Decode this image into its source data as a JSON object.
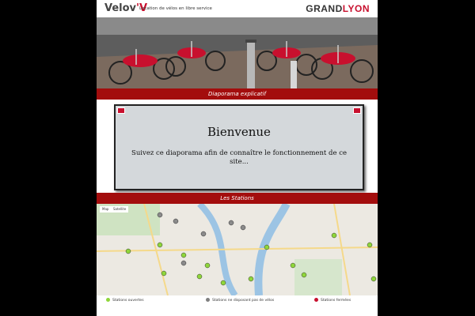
{
  "header": {
    "logo_main": "Velov",
    "logo_accent": "'V",
    "tagline": "Location de vélos en libre service",
    "brand_a": "GRAND",
    "brand_b": "LYON"
  },
  "sections": {
    "diaporama_label": "Diaporama explicatif",
    "stations_label": "Les Stations"
  },
  "slide": {
    "title": "Bienvenue",
    "text": "Suivez ce diaporama afin de connaître le fonctionnement de ce site..."
  },
  "map": {
    "map_button": "Map",
    "satellite_button": "Satellite"
  },
  "legend": {
    "open": "Stations ouvertes",
    "no_bikes": "Stations ne disposant pas de vélos",
    "closed": "Stations fermées"
  },
  "colors": {
    "accent": "#a30d0d",
    "open": "#8fd63a",
    "no_bikes": "#7f7f7f",
    "closed": "#c8102e"
  }
}
